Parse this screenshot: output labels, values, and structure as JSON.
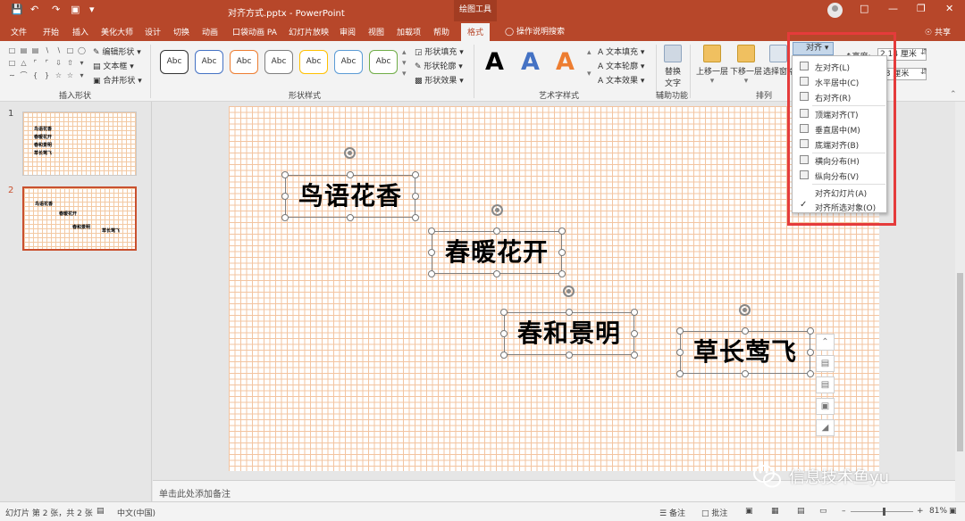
{
  "window": {
    "title": "对齐方式.pptx - PowerPoint",
    "context_tab": "绘图工具",
    "share": "共享"
  },
  "tabs": [
    "文件",
    "开始",
    "插入",
    "美化大师",
    "设计",
    "切换",
    "动画",
    "口袋动画 PA",
    "幻灯片放映",
    "审阅",
    "视图",
    "加载项",
    "帮助",
    "格式"
  ],
  "active_tab": "格式",
  "tell_me": "操作说明搜索",
  "ribbon": {
    "insert_shapes": {
      "label": "插入形状",
      "edit_shape": "编辑形状",
      "text_box": "文本框",
      "merge_shapes": "合并形状"
    },
    "shape_styles": {
      "label": "形状样式",
      "sample_text": "Abc",
      "border_colors": [
        "#333333",
        "#4472c4",
        "#ed7d31",
        "#7f7f7f",
        "#ffc000",
        "#5b9bd5",
        "#70ad47"
      ],
      "fill": "形状填充",
      "outline": "形状轮廓",
      "effects": "形状效果"
    },
    "wordart": {
      "label": "艺术字样式",
      "letter": "A",
      "colors": [
        "#000000",
        "#4472c4",
        "#ed7d31"
      ],
      "text_fill": "文本填充",
      "text_outline": "文本轮廓",
      "text_effects": "文本效果"
    },
    "accessibility": {
      "label": "辅助功能",
      "alt_text_l1": "替换",
      "alt_text_l2": "文字"
    },
    "arrange": {
      "label": "排列",
      "bring_forward": "上移一层",
      "send_backward": "下移一层",
      "selection_pane": "选择窗格",
      "align": "对齐"
    },
    "size": {
      "height_label": "高度:",
      "height_value": "2.14 厘米",
      "width_value": "78 厘米"
    }
  },
  "align_menu": {
    "items": [
      {
        "label": "左对齐(L)",
        "icon": "align-left-icon"
      },
      {
        "label": "水平居中(C)",
        "icon": "align-center-icon"
      },
      {
        "label": "右对齐(R)",
        "icon": "align-right-icon"
      },
      {
        "label": "顶端对齐(T)",
        "icon": "align-top-icon"
      },
      {
        "label": "垂直居中(M)",
        "icon": "align-middle-icon"
      },
      {
        "label": "底端对齐(B)",
        "icon": "align-bottom-icon"
      },
      {
        "label": "横向分布(H)",
        "icon": "distribute-horizontal-icon"
      },
      {
        "label": "纵向分布(V)",
        "icon": "distribute-vertical-icon"
      },
      {
        "label": "对齐幻灯片(A)",
        "icon": "none"
      },
      {
        "label": "对齐所选对象(O)",
        "icon": "check-icon",
        "checked": true
      }
    ]
  },
  "thumbnails": [
    {
      "number": "1",
      "lines": [
        "鸟语花香",
        "春暖花开",
        "春和景明",
        "草长莺飞"
      ]
    },
    {
      "number": "2",
      "lines": [
        "鸟语花香",
        "春暖花开",
        "春和景明",
        "草长莺飞"
      ],
      "selected": true
    }
  ],
  "slide": {
    "textboxes": [
      "鸟语花香",
      "春暖花开",
      "春和景明",
      "草长莺飞"
    ]
  },
  "notes_placeholder": "单击此处添加备注",
  "status": {
    "slide_info": "幻灯片 第 2 张，共 2 张",
    "language": "中文(中国)",
    "notes": "备注",
    "comments": "批注",
    "zoom": "81%"
  },
  "watermark": "信息技术鱼yu",
  "colors": {
    "accent": "#b7472a",
    "highlight_box": "#e53b3b",
    "grid": "#f3c4a0"
  }
}
